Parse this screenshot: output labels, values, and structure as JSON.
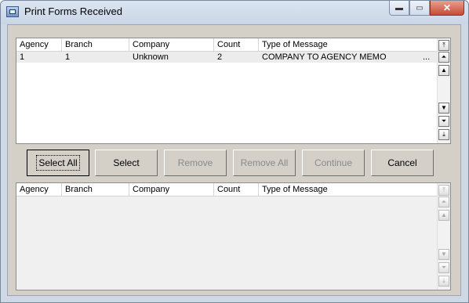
{
  "window": {
    "title": "Print Forms Received",
    "min": "▬",
    "max": "▭",
    "close": "✕"
  },
  "columns": [
    "Agency",
    "Branch",
    "Company",
    "Count",
    "Type of Message"
  ],
  "top_list": {
    "rows": [
      {
        "agency": "1",
        "branch": "1",
        "company": "Unknown",
        "count": "2",
        "type": "COMPANY TO AGENCY MEMO",
        "more": "..."
      }
    ]
  },
  "buttons": {
    "select_all": "Select All",
    "select": "Select",
    "remove": "Remove",
    "remove_all": "Remove All",
    "continue": "Continue",
    "cancel": "Cancel"
  },
  "icons": {
    "top": "scroll-to-top-icon",
    "page_up": "page-up-icon",
    "line_up": "line-up-icon",
    "line_down": "line-down-icon",
    "page_down": "page-down-icon",
    "bottom": "scroll-to-bottom-icon"
  },
  "glyphs": {
    "top": "⤒",
    "page_up": "⏶",
    "up": "▲",
    "down": "▼",
    "page_down": "⏷",
    "bottom": "⤓"
  }
}
